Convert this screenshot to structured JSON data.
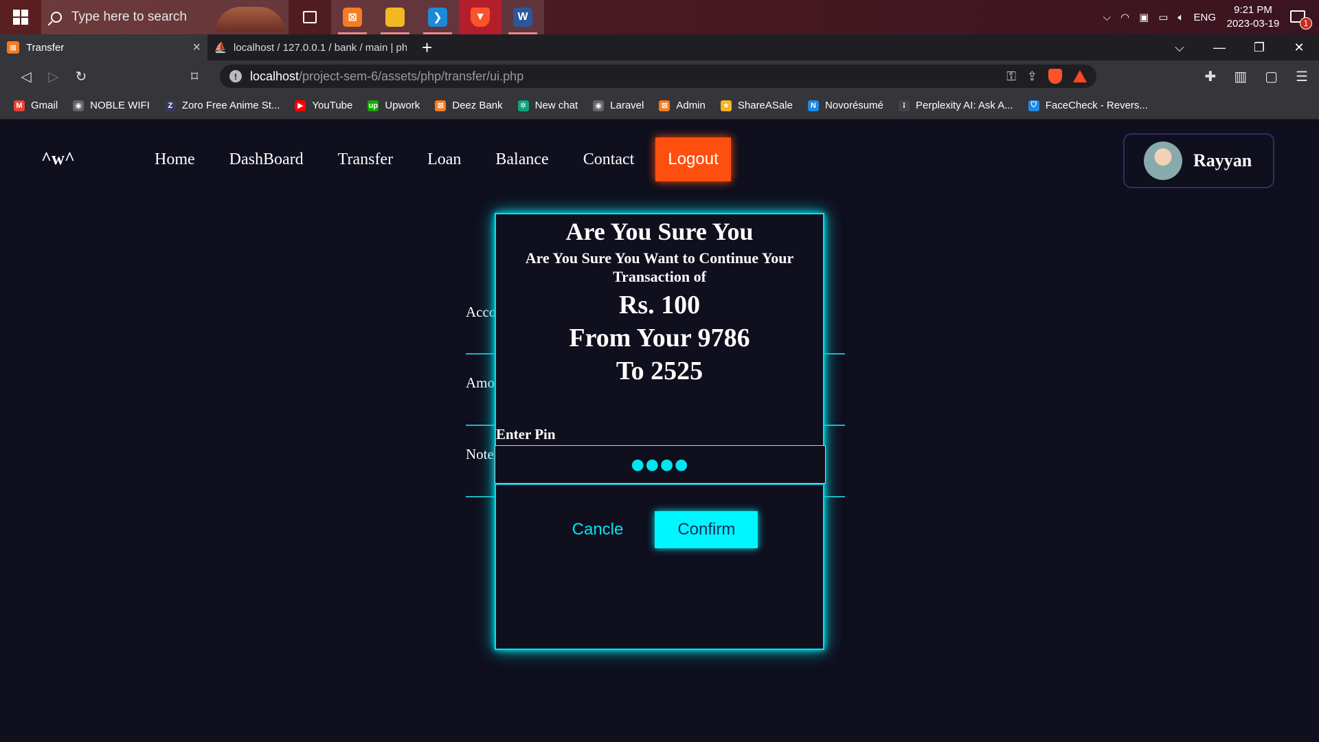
{
  "taskbar": {
    "search_placeholder": "Type here to search",
    "clock_time": "9:21 PM",
    "clock_date": "2023-03-19",
    "language": "ENG",
    "notification_count": "1"
  },
  "browser": {
    "tabs": [
      {
        "title": "Transfer"
      },
      {
        "title": "localhost / 127.0.0.1 / bank / main | ph"
      }
    ],
    "url_host": "localhost",
    "url_path": "/project-sem-6/assets/php/transfer/ui.php",
    "bookmarks": [
      {
        "label": "Gmail",
        "color": "#ea4335",
        "glyph": "M"
      },
      {
        "label": "NOBLE WIFI",
        "color": "#666666",
        "glyph": "◉"
      },
      {
        "label": "Zoro Free Anime St...",
        "color": "#3a3a5a",
        "glyph": "Z"
      },
      {
        "label": "YouTube",
        "color": "#ff0000",
        "glyph": "▶"
      },
      {
        "label": "Upwork",
        "color": "#14a800",
        "glyph": "up"
      },
      {
        "label": "Deez Bank",
        "color": "#f57c21",
        "glyph": "⊠"
      },
      {
        "label": "New chat",
        "color": "#10a37f",
        "glyph": "✲"
      },
      {
        "label": "Laravel",
        "color": "#666666",
        "glyph": "◉"
      },
      {
        "label": "Admin",
        "color": "#f57c21",
        "glyph": "⊠"
      },
      {
        "label": "ShareASale",
        "color": "#f5b622",
        "glyph": "★"
      },
      {
        "label": "Novorésumé",
        "color": "#1e88e5",
        "glyph": "N"
      },
      {
        "label": "Perplexity AI: Ask A...",
        "color": "#444444",
        "glyph": "⁝"
      },
      {
        "label": "FaceCheck - Revers...",
        "color": "#1e88e5",
        "glyph": "⛉"
      }
    ]
  },
  "page": {
    "logo": "^w^",
    "nav": [
      "Home",
      "DashBoard",
      "Transfer",
      "Loan",
      "Balance",
      "Contact"
    ],
    "logout": "Logout",
    "user_name": "Rayyan",
    "form_labels": [
      "Acco",
      "Amo",
      "Note"
    ]
  },
  "modal": {
    "title": "Are You Sure You",
    "subtitle": "Are You Sure You Want to Continue Your Transaction of",
    "amount": "Rs. 100",
    "from_line": "From Your 9786",
    "to_line": "To 2525",
    "pin_label": "Enter Pin",
    "pin_value": "●●●●",
    "cancel": "Cancle",
    "confirm": "Confirm"
  }
}
